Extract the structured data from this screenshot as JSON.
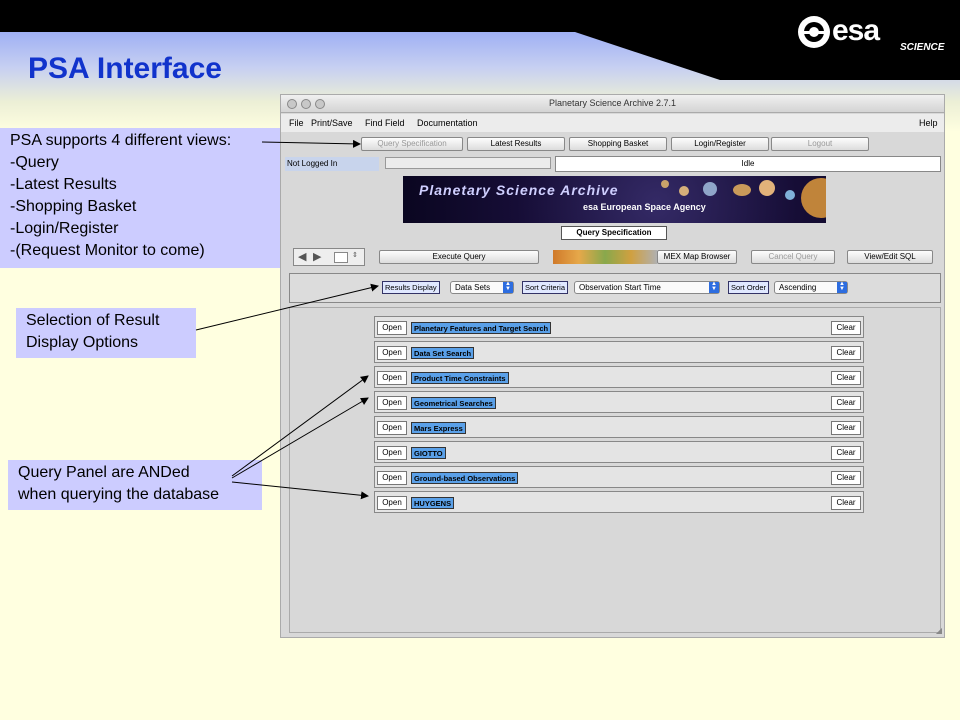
{
  "slide": {
    "title": "PSA Interface",
    "logo_text": "esa",
    "logo_sub": "SCIENCE"
  },
  "callouts": {
    "views": [
      "PSA supports 4 different views:",
      "-Query",
      "-Latest Results",
      "-Shopping Basket",
      "-Login/Register",
      "-(Request Monitor to come)"
    ],
    "selection": [
      "Selection of Result",
      "Display Options"
    ],
    "anded": [
      "Query Panel are ANDed",
      "when querying the database"
    ]
  },
  "window": {
    "title": "Planetary Science Archive 2.7.1",
    "menus": [
      "File",
      "Print/Save",
      "Find Field",
      "Documentation"
    ],
    "help": "Help",
    "view_buttons": [
      {
        "label": "Query Specification",
        "disabled": true
      },
      {
        "label": "Latest Results",
        "disabled": false
      },
      {
        "label": "Shopping Basket",
        "disabled": false
      },
      {
        "label": "Login/Register",
        "disabled": false
      },
      {
        "label": "Logout",
        "disabled": true
      }
    ],
    "login_status": "Not Logged In",
    "status": "Idle",
    "banner_title": "Planetary Science Archive",
    "banner_agency": "esa  European Space Agency",
    "current_view": "Query Specification",
    "actions": {
      "execute": "Execute Query",
      "map": "MEX Map Browser",
      "cancel": "Cancel Query",
      "sql": "View/Edit SQL"
    },
    "display": {
      "results_label": "Results Display",
      "results_value": "Data Sets",
      "sort_label": "Sort Criteria",
      "sort_value": "Observation Start Time",
      "order_label": "Sort Order",
      "order_value": "Ascending"
    },
    "query_panels": [
      "Planetary Features and Target Search",
      "Data Set Search",
      "Product Time Constraints",
      "Geometrical Searches",
      "Mars Express",
      "GIOTTO",
      "Ground-based Observations",
      "HUYGENS"
    ],
    "open_label": "Open",
    "clear_label": "Clear"
  },
  "colors": {
    "title": "#1133cc",
    "callout_bg": "#ccccff",
    "slide_bg": "#ffffe0",
    "panel_highlight": "#5aa0e8"
  }
}
